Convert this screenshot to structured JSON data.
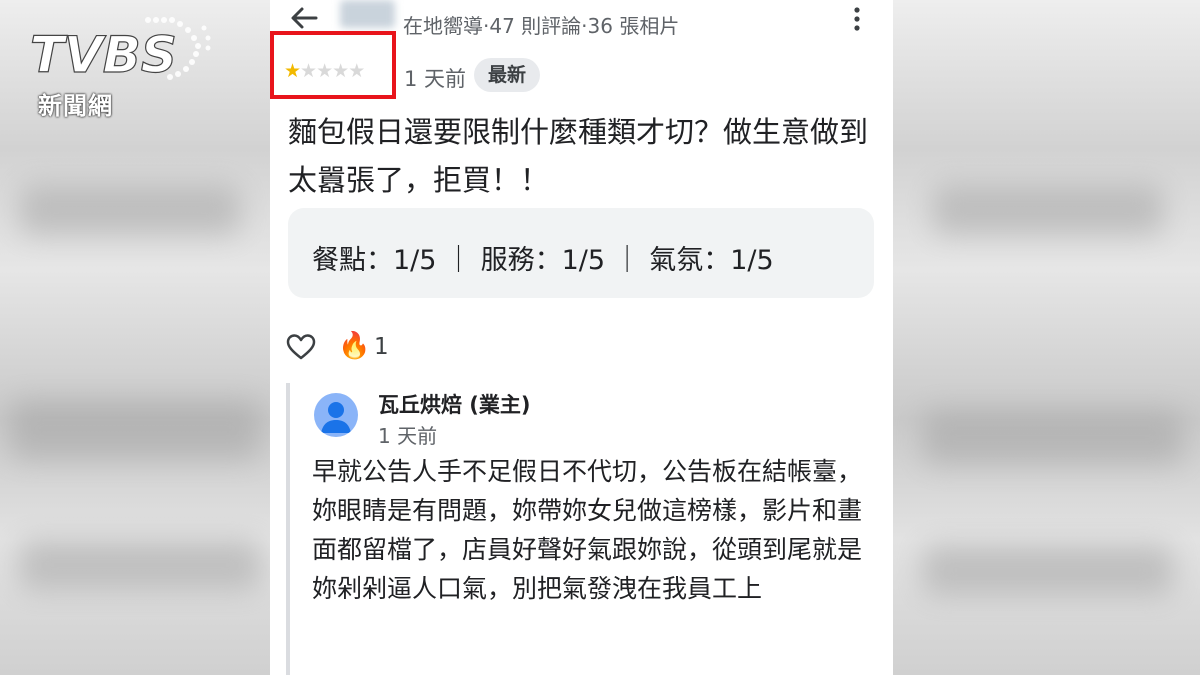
{
  "reviewer": {
    "meta": "在地嚮導‧47 則評論‧36 張相片"
  },
  "rating": {
    "stars_filled": 1,
    "stars_total": 5,
    "time_ago": "1 天前",
    "badge": "最新"
  },
  "review": {
    "text": "麵包假日還要限制什麼種類才切？做生意做到太囂張了，拒買！！",
    "scores": "餐點：1/5 ｜ 服務：1/5 ｜ 氣氛：1/5"
  },
  "reactions": {
    "fire_count": "1"
  },
  "owner_reply": {
    "name": "瓦丘烘焙 (業主)",
    "time_ago": "1 天前",
    "text": "早就公告人手不足假日不代切，公告板在結帳臺，妳眼睛是有問題，妳帶妳女兒做這榜樣，影片和畫面都留檔了，店員好聲好氣跟妳說，從頭到尾就是妳剁剁逼人口氣，別把氣發洩在我員工上"
  },
  "logo": {
    "brand": "TVBS",
    "sub": "新聞網"
  },
  "icons": {
    "back": "arrow-left-icon",
    "more": "more-vert-icon",
    "heart": "heart-icon",
    "fire": "fire-icon",
    "avatar": "person-avatar-icon"
  },
  "colors": {
    "star_filled": "#f2b900",
    "highlight_box": "#e8141b",
    "avatar_bg": "#8ab4f8"
  }
}
